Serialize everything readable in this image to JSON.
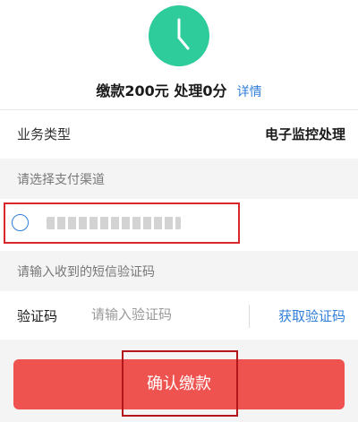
{
  "summary": {
    "main": "缴款200元 处理0分",
    "detail_link": "详情"
  },
  "business_type": {
    "label": "业务类型",
    "value": "电子监控处理"
  },
  "payment": {
    "section_label": "请选择支付渠道",
    "channel_text": ""
  },
  "sms": {
    "section_label": "请输入收到的短信验证码",
    "code_label": "验证码",
    "code_placeholder": "请输入验证码",
    "get_code": "获取验证码"
  },
  "confirm_label": "确认缴款",
  "colors": {
    "clock": "#2ecc9a",
    "accent": "#2f7ed8",
    "button": "#ef5350",
    "highlight": "#d9262a"
  }
}
